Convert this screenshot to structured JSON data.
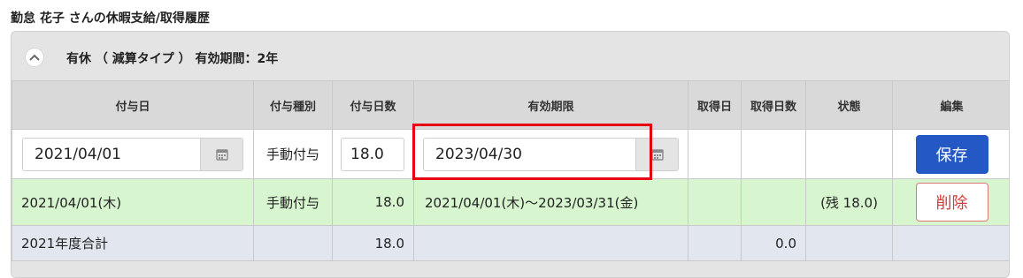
{
  "page_title": "勤怠 花子 さんの休暇支給/取得履歴",
  "panel": {
    "heading": "有休 （ 減算タイプ ） 有効期間：2年",
    "collapse_icon": "chevron-up-icon"
  },
  "table": {
    "headers": {
      "grant_date": "付与日",
      "grant_type": "付与種別",
      "grant_days": "付与日数",
      "expiry": "有効期限",
      "taken_date": "取得日",
      "taken_days": "取得日数",
      "status": "状態",
      "edit": "編集"
    },
    "edit_row": {
      "grant_date": "2021/04/01",
      "grant_type": "手動付与",
      "grant_days": "18.0",
      "expiry": "2023/04/30",
      "save_label": "保存"
    },
    "grant_row": {
      "grant_date": "2021/04/01(木)",
      "grant_type": "手動付与",
      "grant_days": "18.0",
      "period": "2021/04/01(木)～2023/03/31(金)",
      "status": "(残 18.0)",
      "delete_label": "削除"
    },
    "total_row": {
      "label": "2021年度合計",
      "grant_days": "18.0",
      "taken_days": "0.0"
    }
  },
  "colors": {
    "save_button": "#2458c4",
    "delete_text": "#d43a3a",
    "grant_row_bg": "#d7f5cf",
    "total_row_bg": "#e1e6ef",
    "highlight": "#e60012"
  }
}
